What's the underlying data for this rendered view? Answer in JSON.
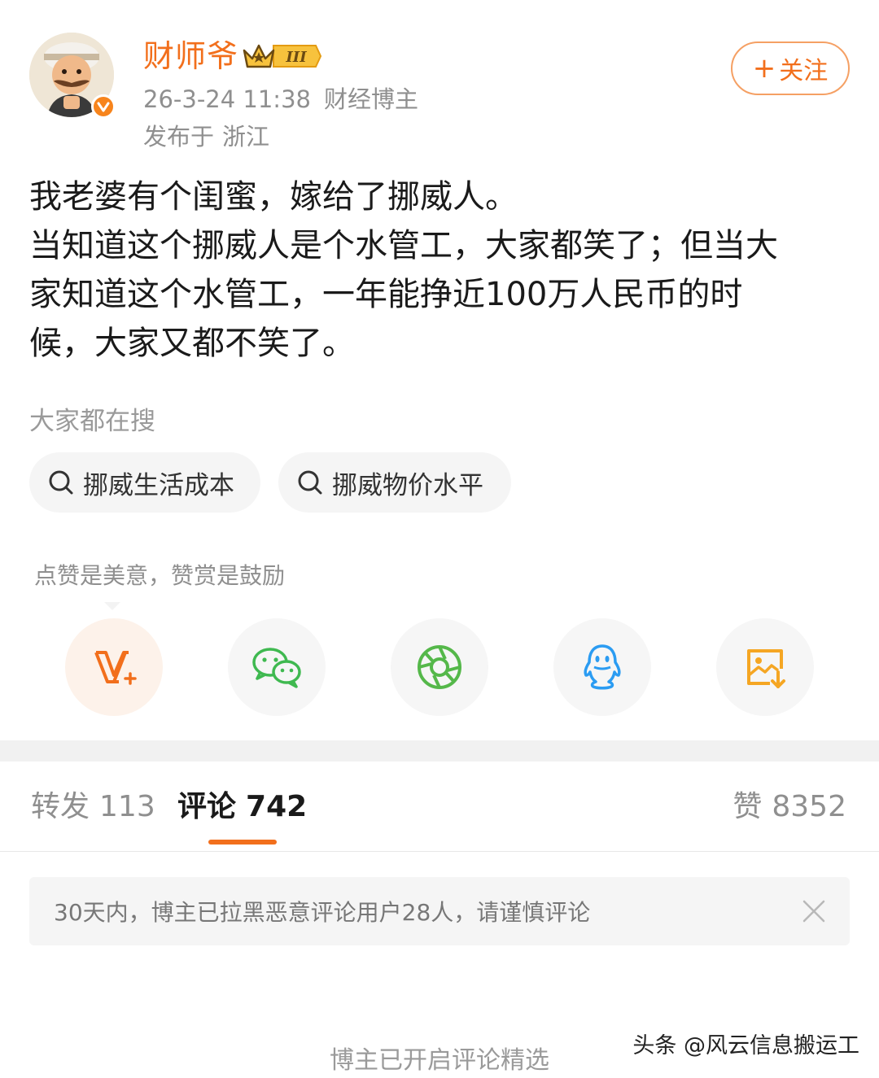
{
  "header": {
    "username": "财师爷",
    "vip_level": "III",
    "date": "26-3-24",
    "time": "11:38",
    "author_tag": "财经博主",
    "location_prefix": "发布于",
    "location": "浙江",
    "follow_label": "关注"
  },
  "post": {
    "lines": [
      "我老婆有个闺蜜，嫁给了挪威人。",
      "当知道这个挪威人是个水管工，大家都笑了；但当大",
      "家知道这个水管工，一年能挣近100万人民币的时",
      "候，大家又都不笑了。"
    ]
  },
  "search": {
    "heading": "大家都在搜",
    "chips": [
      "挪威生活成本",
      "挪威物价水平"
    ]
  },
  "reward": {
    "tip": "点赞是美意，赞赏是鼓励"
  },
  "share": {
    "items": [
      "reward-icon",
      "wechat-icon",
      "moments-icon",
      "qq-icon",
      "save-image-icon"
    ]
  },
  "tabs": {
    "repost_label": "转发",
    "repost_count": "113",
    "comment_label": "评论",
    "comment_count": "742",
    "like_label": "赞",
    "like_count": "8352"
  },
  "notice": {
    "text": "30天内，博主已拉黑恶意评论用户28人，请谨慎评论"
  },
  "footer": {
    "selected_note": "博主已开启评论精选",
    "watermark": "头条 @风云信息搬运工"
  },
  "colors": {
    "accent": "#f26f1c",
    "wechat": "#3fb950",
    "moments": "#55b84a",
    "qq": "#2b9cf2",
    "save": "#f5a623"
  }
}
